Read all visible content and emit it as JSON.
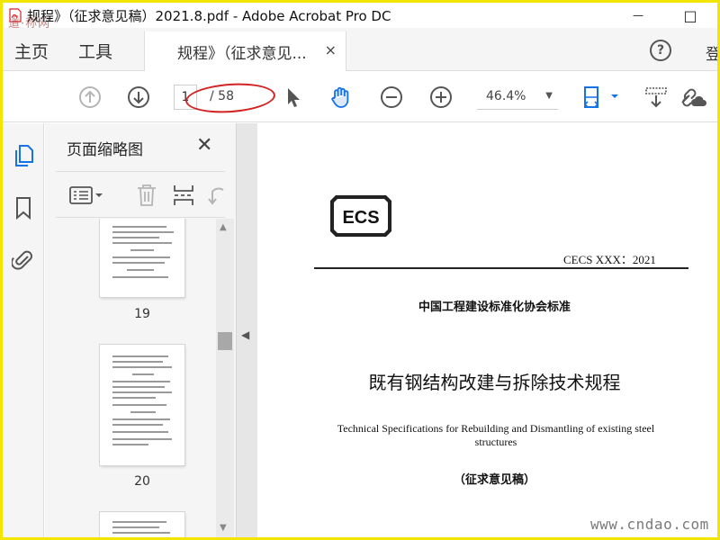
{
  "window": {
    "title": "规程》（征求意见稿）2021.8.pdf - Adobe Acrobat Pro DC",
    "minimize_glyph": "—",
    "maximize_glyph": "□"
  },
  "watermark": {
    "logo_text": "道·称网",
    "site_text": "www.cndao.com"
  },
  "menubar": {
    "home": "主页",
    "tools": "工具",
    "doc_tab_label": "规程》（征求意见...",
    "doc_tab_close": "×",
    "help_glyph": "?",
    "login": "登"
  },
  "toolbar": {
    "current_page": "1",
    "total_pages": "/ 58",
    "zoom": "46.4%",
    "zoom_caret": "▼"
  },
  "thumbnails_panel": {
    "title": "页面缩略图",
    "close_glyph": "✕",
    "pages": [
      {
        "label": "19"
      },
      {
        "label": "20"
      },
      {
        "label": ""
      }
    ]
  },
  "document": {
    "logo_text": "ECS",
    "code": "CECS XXX：2021",
    "org": "中国工程建设标准化协会标准",
    "title": "既有钢结构改建与拆除技术规程",
    "english_title": "Technical Specifications for Rebuilding and Dismantling of existing steel structures",
    "draft_label": "（征求意见稿）"
  },
  "colors": {
    "frame_border": "#f2e600",
    "accent_blue": "#1473e6",
    "annotation_red": "#d32222"
  },
  "icons": {
    "toolbar": [
      "arrow-up-circle-icon",
      "arrow-down-circle-icon",
      "cursor-arrow-icon",
      "hand-icon",
      "zoom-out-icon",
      "zoom-in-icon",
      "fit-page-icon",
      "scrolling-mode-icon",
      "link-cloud-icon"
    ],
    "rail": [
      "page-thumbnails-icon",
      "bookmark-icon",
      "attachment-icon"
    ],
    "panel_tools": [
      "thumbnail-options-icon",
      "delete-icon",
      "insert-page-icon",
      "undo-icon"
    ]
  }
}
